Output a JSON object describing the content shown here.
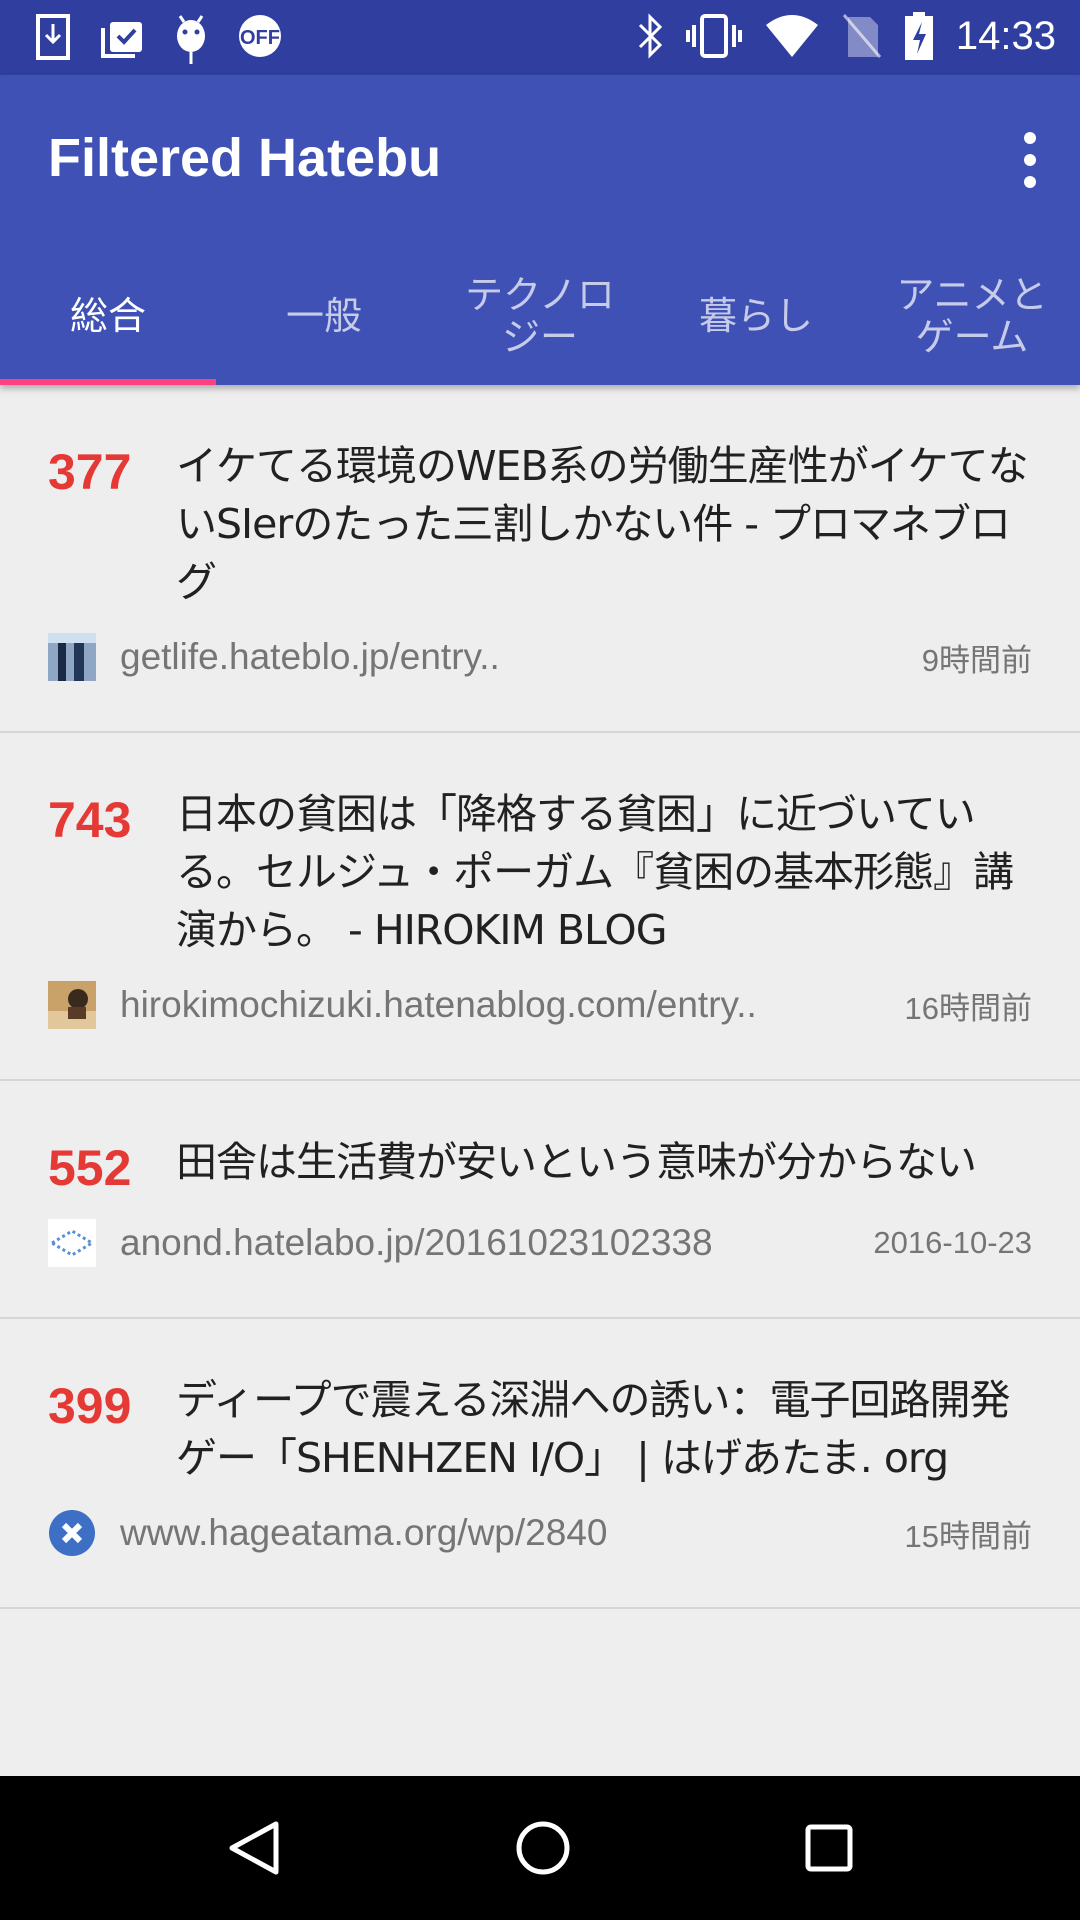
{
  "status_bar": {
    "time": "14:33",
    "left_icons": [
      "download-icon",
      "clipboard-check-icon",
      "android-icon",
      "off-badge-icon"
    ],
    "right_icons": [
      "bluetooth-icon",
      "vibrate-icon",
      "wifi-icon",
      "no-sim-icon",
      "battery-charging-icon"
    ],
    "off_label": "OFF"
  },
  "app_bar": {
    "title": "Filtered Hatebu",
    "menu_icon": "more-vert-icon"
  },
  "tabs": [
    {
      "label": "総合",
      "active": true
    },
    {
      "label": "一般"
    },
    {
      "label": "テクノロ\nジー"
    },
    {
      "label": "暮らし"
    },
    {
      "label": "アニメと\nゲーム"
    }
  ],
  "colors": {
    "primary": "#3f51b5",
    "primary_dark": "#303f9f",
    "accent": "#ff4081",
    "score": "#e53935"
  },
  "entries": [
    {
      "score": "377",
      "title": "イケてる環境のWEB系の労働生産性がイケてないSIerのたった三割しかない件 - プロマネブログ",
      "url": "getlife.hateblo.jp/entry..",
      "time": "9時間前"
    },
    {
      "score": "743",
      "title": "日本の貧困は「降格する貧困」に近づいている。セルジュ・ポーガム『貧困の基本形態』講演から。 - HIROKIM BLOG",
      "url": "hirokimochizuki.hatenablog.com/entry..",
      "time": "16時間前"
    },
    {
      "score": "552",
      "title": "田舎は生活費が安いという意味が分からない",
      "url": "anond.hatelabo.jp/20161023102338",
      "time": "2016-10-23"
    },
    {
      "score": "399",
      "title": "ディープで震える深淵への誘い：電子回路開発ゲー「SHENHZEN I/O」 | はげあたま. org",
      "url": "www.hageatama.org/wp/2840",
      "time": "15時間前"
    }
  ],
  "nav_bar": [
    "back-icon",
    "home-icon",
    "recents-icon"
  ]
}
